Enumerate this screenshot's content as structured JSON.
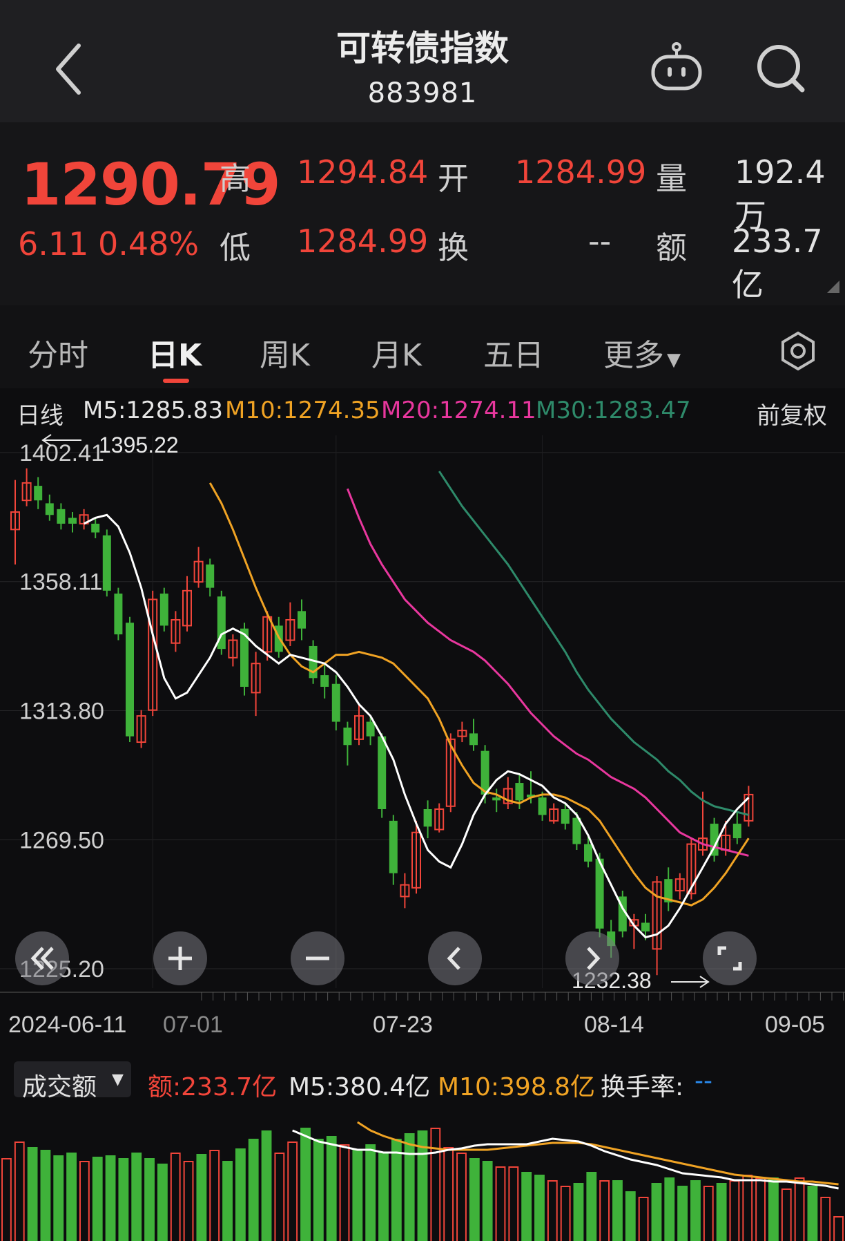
{
  "header": {
    "title": "可转债指数",
    "code": "883981",
    "back_icon": "chevron-left-icon",
    "robot_icon": "robot-icon",
    "search_icon": "search-icon"
  },
  "quote": {
    "price": "1290.79",
    "change": "6.11",
    "change_pct": "0.48%",
    "high_label": "高",
    "high": "1294.84",
    "low_label": "低",
    "low": "1284.99",
    "open_label": "开",
    "open": "1284.99",
    "turnover_label": "换",
    "turnover": "--",
    "volume_label": "量",
    "volume": "192.4万",
    "amount_label": "额",
    "amount": "233.7亿"
  },
  "tabs": [
    "分时",
    "日K",
    "周K",
    "月K",
    "五日",
    "更多"
  ],
  "ma": {
    "period": "日线",
    "m5": "M5:1285.83",
    "m10": "M10:1274.35",
    "m20": "M20:1274.11",
    "m30": "M30:1283.47",
    "adjust": "前复权"
  },
  "colors": {
    "up": "#f1453a",
    "down": "#3fb23a",
    "m5": "#ffffff",
    "m10": "#f0a324",
    "m20": "#e8379e",
    "m30": "#2e8a6a",
    "turnover_value": "#2a8cf0"
  },
  "volume_header": {
    "selector": "成交额",
    "amount": "额:233.7亿",
    "m5": "M5:380.4亿",
    "m10": "M10:398.8亿",
    "turnover_label": "换手率:",
    "turnover_value": "--"
  },
  "chart_data": {
    "type": "candlestick",
    "y_tick_labels": [
      "1402.41",
      "1358.11",
      "1313.80",
      "1269.50",
      "1225.20"
    ],
    "x_tick_labels": [
      "2024-06-11",
      "07-01",
      "07-23",
      "08-14",
      "09-05"
    ],
    "annotations": {
      "max": "1395.22",
      "min": "1232.38"
    },
    "candles": [
      [
        1376,
        1382,
        1393,
        1364
      ],
      [
        1386,
        1392,
        1397,
        1384
      ],
      [
        1391,
        1386,
        1394,
        1383
      ],
      [
        1385,
        1381,
        1388,
        1379
      ],
      [
        1383,
        1378,
        1385,
        1376
      ],
      [
        1380,
        1378,
        1382,
        1375
      ],
      [
        1378,
        1381,
        1383,
        1376
      ],
      [
        1378,
        1375,
        1380,
        1373
      ],
      [
        1374,
        1355,
        1376,
        1353
      ],
      [
        1354,
        1340,
        1356,
        1338
      ],
      [
        1344,
        1305,
        1346,
        1303
      ],
      [
        1303,
        1312,
        1314,
        1301
      ],
      [
        1314,
        1352,
        1355,
        1312
      ],
      [
        1354,
        1343,
        1356,
        1341
      ],
      [
        1337,
        1345,
        1348,
        1334
      ],
      [
        1343,
        1355,
        1360,
        1341
      ],
      [
        1358,
        1365,
        1370,
        1356
      ],
      [
        1364,
        1356,
        1366,
        1353
      ],
      [
        1353,
        1335,
        1355,
        1333
      ],
      [
        1332,
        1338,
        1340,
        1329
      ],
      [
        1342,
        1322,
        1344,
        1319
      ],
      [
        1320,
        1330,
        1334,
        1312
      ],
      [
        1334,
        1346,
        1348,
        1331
      ],
      [
        1343,
        1334,
        1346,
        1332
      ],
      [
        1338,
        1345,
        1351,
        1336
      ],
      [
        1348,
        1342,
        1352,
        1338
      ],
      [
        1336,
        1325,
        1338,
        1323
      ],
      [
        1326,
        1322,
        1330,
        1318
      ],
      [
        1323,
        1310,
        1326,
        1307
      ],
      [
        1308,
        1302,
        1310,
        1295
      ],
      [
        1304,
        1312,
        1316,
        1302
      ],
      [
        1310,
        1305,
        1312,
        1302
      ],
      [
        1305,
        1280,
        1306,
        1277
      ],
      [
        1276,
        1258,
        1278,
        1254
      ],
      [
        1250,
        1254,
        1258,
        1246
      ],
      [
        1253,
        1272,
        1276,
        1251
      ],
      [
        1280,
        1274,
        1283,
        1270
      ],
      [
        1273,
        1280,
        1282,
        1272
      ],
      [
        1281,
        1304,
        1306,
        1279
      ],
      [
        1305,
        1307,
        1310,
        1303
      ],
      [
        1306,
        1302,
        1311,
        1300
      ],
      [
        1300,
        1285,
        1302,
        1282
      ],
      [
        1284,
        1283,
        1287,
        1279
      ],
      [
        1282,
        1287,
        1291,
        1280
      ],
      [
        1289,
        1283,
        1292,
        1280
      ],
      [
        1285,
        1284,
        1293,
        1282
      ],
      [
        1284,
        1278,
        1286,
        1276
      ],
      [
        1276,
        1280,
        1282,
        1275
      ],
      [
        1280,
        1275,
        1282,
        1273
      ],
      [
        1277,
        1268,
        1279,
        1266
      ],
      [
        1268,
        1262,
        1271,
        1260
      ],
      [
        1263,
        1239,
        1265,
        1236
      ],
      [
        1238,
        1233,
        1242,
        1229
      ],
      [
        1250,
        1238,
        1252,
        1236
      ],
      [
        1240,
        1242,
        1244,
        1232
      ],
      [
        1241,
        1238,
        1244,
        1235
      ],
      [
        1232,
        1255,
        1257,
        1223
      ],
      [
        1256,
        1248,
        1260,
        1245
      ],
      [
        1252,
        1256,
        1258,
        1249
      ],
      [
        1251,
        1268,
        1270,
        1249
      ],
      [
        1266,
        1270,
        1286,
        1264
      ],
      [
        1275,
        1264,
        1277,
        1262
      ],
      [
        1266,
        1271,
        1276,
        1264
      ],
      [
        1275,
        1270,
        1279,
        1268
      ],
      [
        1276,
        1285,
        1288,
        1274
      ]
    ],
    "ma5": [
      1378,
      1380,
      1381,
      1377,
      1368,
      1356,
      1340,
      1325,
      1318,
      1320,
      1326,
      1332,
      1340,
      1342,
      1340,
      1336,
      1333,
      1330,
      1333,
      1332,
      1331,
      1330,
      1327,
      1322,
      1316,
      1312,
      1305,
      1297,
      1285,
      1275,
      1266,
      1262,
      1260,
      1268,
      1278,
      1285,
      1290,
      1293,
      1292,
      1290,
      1288,
      1284,
      1282,
      1278,
      1271,
      1262,
      1254,
      1246,
      1240,
      1236,
      1237,
      1240,
      1246,
      1253,
      1260,
      1267,
      1275,
      1280,
      1284
    ],
    "ma10": [
      1392,
      1385,
      1376,
      1366,
      1356,
      1347,
      1339,
      1333,
      1329,
      1327,
      1330,
      1333,
      1333,
      1334,
      1333,
      1332,
      1330,
      1326,
      1322,
      1318,
      1311,
      1302,
      1295,
      1289,
      1286,
      1285,
      1283,
      1282,
      1284,
      1285,
      1285,
      1284,
      1282,
      1280,
      1276,
      1270,
      1264,
      1258,
      1253,
      1250,
      1249,
      1248,
      1247,
      1249,
      1253,
      1258,
      1264,
      1270
    ],
    "ma20": [
      1390,
      1380,
      1371,
      1364,
      1358,
      1352,
      1348,
      1344,
      1341,
      1338,
      1336,
      1334,
      1331,
      1327,
      1323,
      1318,
      1313,
      1309,
      1305,
      1302,
      1299,
      1297,
      1294,
      1291,
      1289,
      1287,
      1284,
      1280,
      1276,
      1272,
      1270,
      1268,
      1267,
      1266,
      1265,
      1264
    ],
    "ma30": [
      1396,
      1390,
      1384,
      1379,
      1374,
      1369,
      1364,
      1358,
      1352,
      1346,
      1340,
      1334,
      1327,
      1321,
      1316,
      1311,
      1307,
      1303,
      1300,
      1297,
      1293,
      1290,
      1286,
      1283,
      1281,
      1280,
      1279,
      1278
    ],
    "volume_bars": [
      [
        1,
        0.6
      ],
      [
        1,
        0.72
      ],
      [
        0,
        0.68
      ],
      [
        0,
        0.66
      ],
      [
        0,
        0.62
      ],
      [
        0,
        0.64
      ],
      [
        1,
        0.58
      ],
      [
        0,
        0.61
      ],
      [
        0,
        0.62
      ],
      [
        0,
        0.6
      ],
      [
        0,
        0.64
      ],
      [
        0,
        0.6
      ],
      [
        0,
        0.56
      ],
      [
        1,
        0.64
      ],
      [
        1,
        0.58
      ],
      [
        0,
        0.63
      ],
      [
        1,
        0.66
      ],
      [
        0,
        0.58
      ],
      [
        0,
        0.67
      ],
      [
        0,
        0.74
      ],
      [
        0,
        0.8
      ],
      [
        1,
        0.64
      ],
      [
        1,
        0.72
      ],
      [
        0,
        0.82
      ],
      [
        0,
        0.74
      ],
      [
        0,
        0.76
      ],
      [
        1,
        0.7
      ],
      [
        0,
        0.66
      ],
      [
        0,
        0.7
      ],
      [
        0,
        0.64
      ],
      [
        0,
        0.74
      ],
      [
        0,
        0.78
      ],
      [
        0,
        0.8
      ],
      [
        1,
        0.82
      ],
      [
        1,
        0.68
      ],
      [
        1,
        0.64
      ],
      [
        0,
        0.6
      ],
      [
        0,
        0.58
      ],
      [
        1,
        0.54
      ],
      [
        1,
        0.54
      ],
      [
        0,
        0.5
      ],
      [
        0,
        0.48
      ],
      [
        1,
        0.44
      ],
      [
        1,
        0.4
      ],
      [
        0,
        0.42
      ],
      [
        0,
        0.5
      ],
      [
        1,
        0.44
      ],
      [
        0,
        0.44
      ],
      [
        0,
        0.36
      ],
      [
        1,
        0.32
      ],
      [
        0,
        0.42
      ],
      [
        0,
        0.46
      ],
      [
        0,
        0.4
      ],
      [
        0,
        0.44
      ],
      [
        1,
        0.4
      ],
      [
        0,
        0.42
      ],
      [
        1,
        0.44
      ],
      [
        1,
        0.48
      ],
      [
        1,
        0.46
      ],
      [
        0,
        0.46
      ],
      [
        1,
        0.38
      ],
      [
        1,
        0.46
      ],
      [
        0,
        0.4
      ],
      [
        1,
        0.32
      ],
      [
        1,
        0.18
      ]
    ],
    "volume_m5": [
      0.8,
      0.76,
      0.72,
      0.7,
      0.68,
      0.66,
      0.66,
      0.64,
      0.64,
      0.63,
      0.63,
      0.64,
      0.66,
      0.67,
      0.69,
      0.7,
      0.7,
      0.7,
      0.7,
      0.72,
      0.74,
      0.73,
      0.72,
      0.69,
      0.65,
      0.62,
      0.59,
      0.57,
      0.55,
      0.52,
      0.49,
      0.48,
      0.47,
      0.46,
      0.44,
      0.44,
      0.44,
      0.43,
      0.43,
      0.42,
      0.41,
      0.4,
      0.38
    ],
    "volume_m10": [
      0.86,
      0.8,
      0.76,
      0.73,
      0.7,
      0.68,
      0.67,
      0.66,
      0.66,
      0.66,
      0.66,
      0.67,
      0.68,
      0.69,
      0.7,
      0.71,
      0.71,
      0.71,
      0.7,
      0.68,
      0.66,
      0.64,
      0.62,
      0.6,
      0.58,
      0.56,
      0.54,
      0.52,
      0.5,
      0.48,
      0.47,
      0.46,
      0.45,
      0.44,
      0.43,
      0.43,
      0.42,
      0.41
    ]
  }
}
